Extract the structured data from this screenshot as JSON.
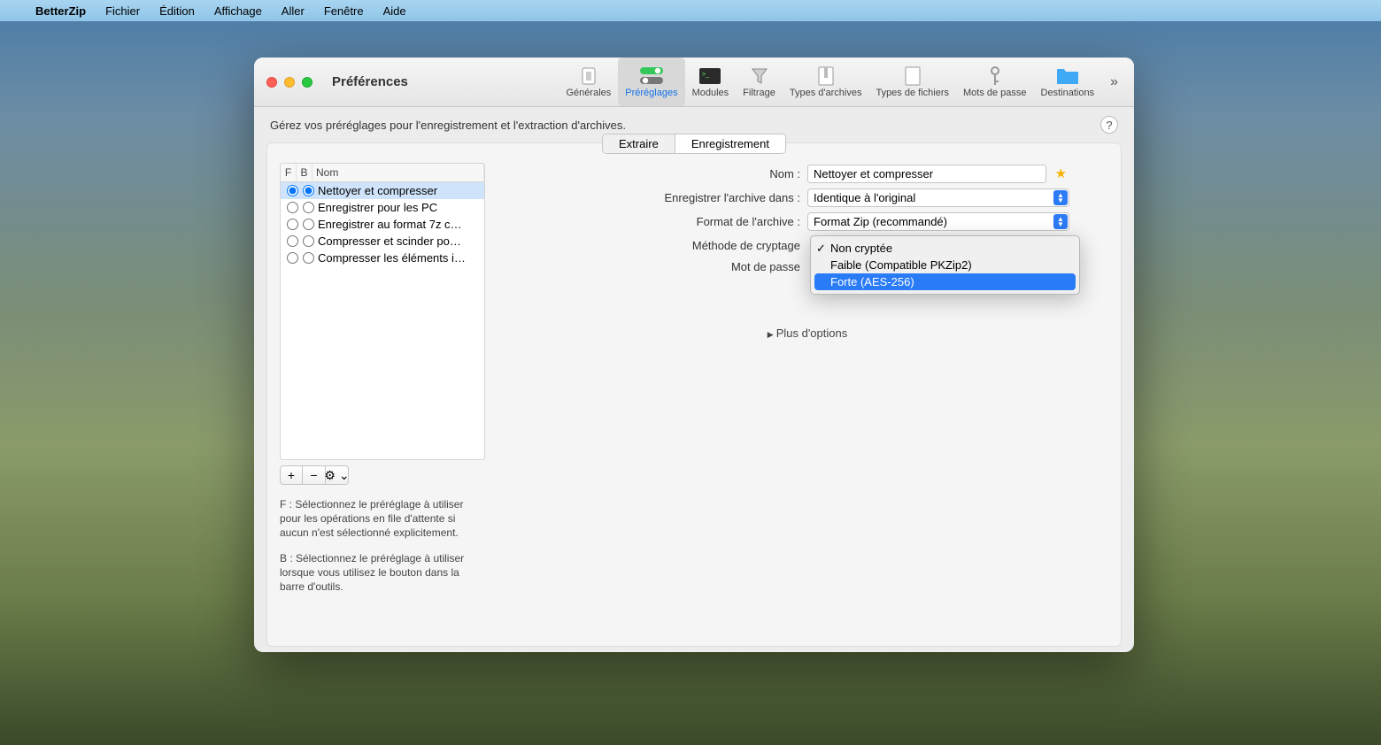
{
  "menubar": {
    "app": "BetterZip",
    "items": [
      "Fichier",
      "Édition",
      "Affichage",
      "Aller",
      "Fenêtre",
      "Aide"
    ]
  },
  "window": {
    "title": "Préférences"
  },
  "toolbar": {
    "items": [
      {
        "name": "generales",
        "label": "Générales"
      },
      {
        "name": "prereglages",
        "label": "Préréglages"
      },
      {
        "name": "modules",
        "label": "Modules"
      },
      {
        "name": "filtrage",
        "label": "Filtrage"
      },
      {
        "name": "types-archives",
        "label": "Types d'archives"
      },
      {
        "name": "types-fichiers",
        "label": "Types de fichiers"
      },
      {
        "name": "mots-de-passe",
        "label": "Mots de passe"
      },
      {
        "name": "destinations",
        "label": "Destinations"
      }
    ],
    "overflow": "»"
  },
  "description": "Gérez vos préréglages pour l'enregistrement et l'extraction d'archives.",
  "help_symbol": "?",
  "segments": {
    "extract": "Extraire",
    "save": "Enregistrement"
  },
  "preset_table": {
    "col_f": "F",
    "col_b": "B",
    "col_name": "Nom",
    "rows": [
      {
        "name": "Nettoyer et compresser",
        "f": true,
        "b": true,
        "selected": true
      },
      {
        "name": "Enregistrer pour les PC",
        "f": false,
        "b": false,
        "selected": false
      },
      {
        "name": "Enregistrer au format 7z c…",
        "f": false,
        "b": false,
        "selected": false
      },
      {
        "name": "Compresser et scinder po…",
        "f": false,
        "b": false,
        "selected": false
      },
      {
        "name": "Compresser les éléments i…",
        "f": false,
        "b": false,
        "selected": false
      }
    ]
  },
  "row_buttons": {
    "add": "+",
    "remove": "−",
    "gear": "⚙︎",
    "drop": "⌄"
  },
  "help_f": "F : Sélectionnez le préréglage à utiliser pour les opérations en file d'attente si aucun n'est sélectionné explicitement.",
  "help_b": "B : Sélectionnez le préréglage à utiliser lorsque vous utilisez le bouton dans la barre d'outils.",
  "form": {
    "name_label": "Nom :",
    "name_value": "Nettoyer et compresser",
    "save_in_label": "Enregistrer l'archive dans :",
    "save_in_value": "Identique à l'original",
    "format_label": "Format de l'archive :",
    "format_value": "Format Zip (recommandé)",
    "encryption_label": "Méthode de cryptage",
    "password_label": "Mot de passe",
    "more_options": "Plus d'options"
  },
  "encryption_menu": {
    "items": [
      {
        "label": "Non cryptée",
        "checked": true,
        "highlight": false
      },
      {
        "label": "Faible (Compatible PKZip2)",
        "checked": false,
        "highlight": false
      },
      {
        "label": "Forte (AES-256)",
        "checked": false,
        "highlight": true
      }
    ]
  }
}
